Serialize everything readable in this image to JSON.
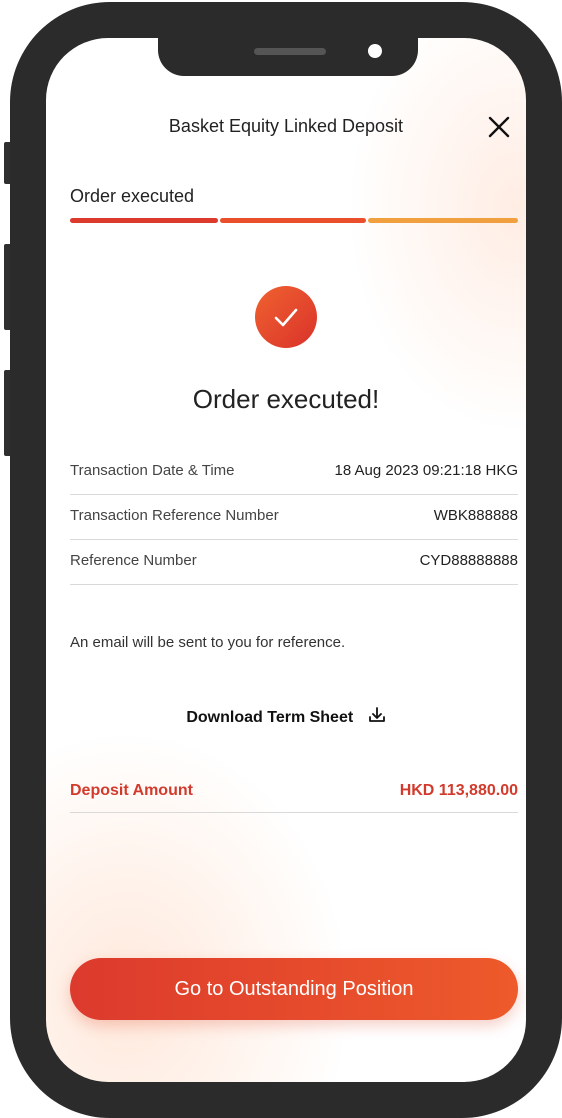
{
  "header": {
    "title": "Basket Equity Linked Deposit"
  },
  "progress": {
    "step_label": "Order executed",
    "steps_total": 3,
    "steps_completed": 3,
    "colors": [
      "#dc3a2d",
      "#ea4f2c",
      "#f1a040"
    ]
  },
  "result": {
    "title": "Order executed!",
    "icon": "check-icon"
  },
  "details": {
    "rows": [
      {
        "label": "Transaction Date & Time",
        "value": "18 Aug 2023 09:21:18 HKG"
      },
      {
        "label": "Transaction Reference Number",
        "value": "WBK888888"
      },
      {
        "label": "Reference Number",
        "value": "CYD88888888"
      }
    ]
  },
  "email_note": "An email will be sent to you for reference.",
  "download": {
    "label": "Download Term Sheet",
    "icon": "download-icon"
  },
  "deposit": {
    "label": "Deposit Amount",
    "value": "HKD 113,880.00"
  },
  "cta": {
    "label": "Go to Outstanding Position"
  },
  "colors": {
    "accent": "#dc3a2d",
    "accent_light": "#ee5a2b",
    "frame": "#2b2b2b"
  }
}
